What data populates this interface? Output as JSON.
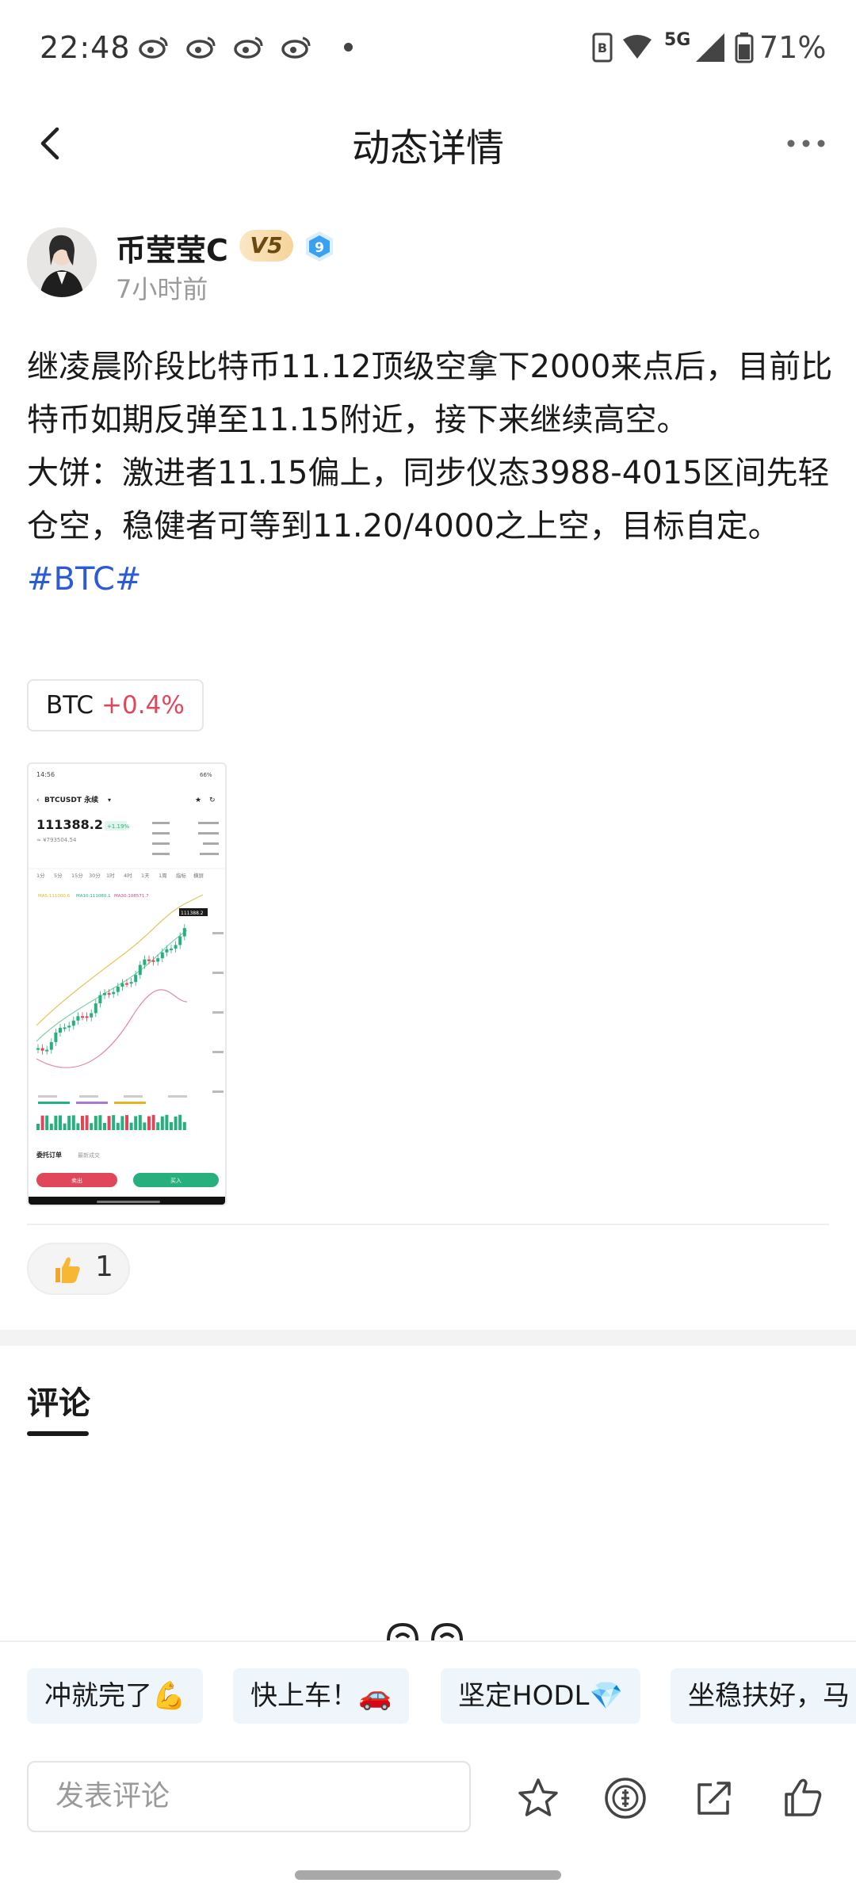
{
  "status_bar": {
    "time": "22:48",
    "network": "5G",
    "battery": "71%",
    "notification_icons": [
      "weibo-icon",
      "weibo-icon",
      "weibo-icon",
      "weibo-icon"
    ]
  },
  "header": {
    "title": "动态详情"
  },
  "author": {
    "name": "币莹莹C",
    "vip_level": "V5",
    "badge_level": "9",
    "posted": "7小时前"
  },
  "post": {
    "paragraph_1": "继凌晨阶段比特币11.12顶级空拿下2000来点后，目前比特币如期反弹至11.15附近，接下来继续高空。",
    "paragraph_2": "大饼：激进者11.15偏上，同步仪态3988-4015区间先轻仓空，稳健者可等到11.20/4000之上空，目标自定。",
    "hashtag": "#BTC#"
  },
  "ticker": {
    "symbol": "BTC",
    "change": "+0.4%"
  },
  "image": {
    "status_time": "14:56",
    "battery": "66%",
    "pair": "BTCUSDT 永续",
    "price": "111388.2",
    "change": "+1.19%",
    "price_sub": "≈ ¥793504.54",
    "tabs": [
      "1分",
      "5分",
      "15分",
      "30分",
      "1时",
      "4时",
      "1天",
      "1周",
      "指标",
      "横屏"
    ],
    "orders_tab": "委托订单",
    "trades_tab": "最新成交",
    "sell_label": "卖出",
    "buy_label": "买入",
    "colors": {
      "up": "#26b07d",
      "down": "#e0475b"
    }
  },
  "reactions": {
    "emoji": "thumbs-up-emoji",
    "count": "1"
  },
  "comments": {
    "title": "评论"
  },
  "quick_replies": [
    "冲就完了💪",
    "快上车！🚗",
    "坚定HODL💎",
    "坐稳扶好，马"
  ],
  "bottom_bar": {
    "input_placeholder": "发表评论",
    "icons": [
      "star-icon",
      "coin-icon",
      "share-icon",
      "thumbs-up-icon"
    ]
  }
}
